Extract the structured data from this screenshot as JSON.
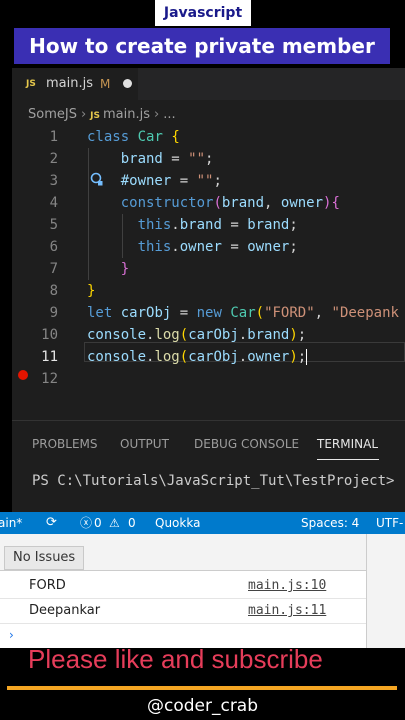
{
  "header": {
    "label": "Javascript",
    "title": "How to create private member"
  },
  "editor": {
    "tab": {
      "icon": "JS",
      "filename": "main.js",
      "modified_badge": "M"
    },
    "breadcrumb": {
      "folder": "SomeJS",
      "file_icon": "JS",
      "file": "main.js",
      "tail": "..."
    },
    "line_numbers": [
      "1",
      "2",
      "3",
      "4",
      "5",
      "6",
      "7",
      "8",
      "9",
      "10",
      "11",
      "12"
    ],
    "active_line": "11"
  },
  "panel": {
    "tabs": [
      "PROBLEMS",
      "OUTPUT",
      "DEBUG CONSOLE",
      "TERMINAL"
    ],
    "active_tab": "TERMINAL",
    "terminal_text": "PS C:\\Tutorials\\JavaScript_Tut\\TestProject>"
  },
  "statusbar": {
    "branch": "ain*",
    "errors": "0",
    "warnings": "0",
    "extension": "Quokka",
    "spaces": "Spaces: 4",
    "encoding": "UTF-"
  },
  "console": {
    "issues_label": "No Issues",
    "rows": [
      {
        "message": "FORD",
        "source": "main.js:10"
      },
      {
        "message": "Deepankar",
        "source": "main.js:11"
      }
    ]
  },
  "footer": {
    "subscribe": "Please like and subscribe",
    "handle": "@coder_crab"
  },
  "colors": {
    "accent": "#3a2fb3",
    "status_bar": "#007acc",
    "subscribe": "#e63d5a",
    "divider": "#f5a623"
  }
}
